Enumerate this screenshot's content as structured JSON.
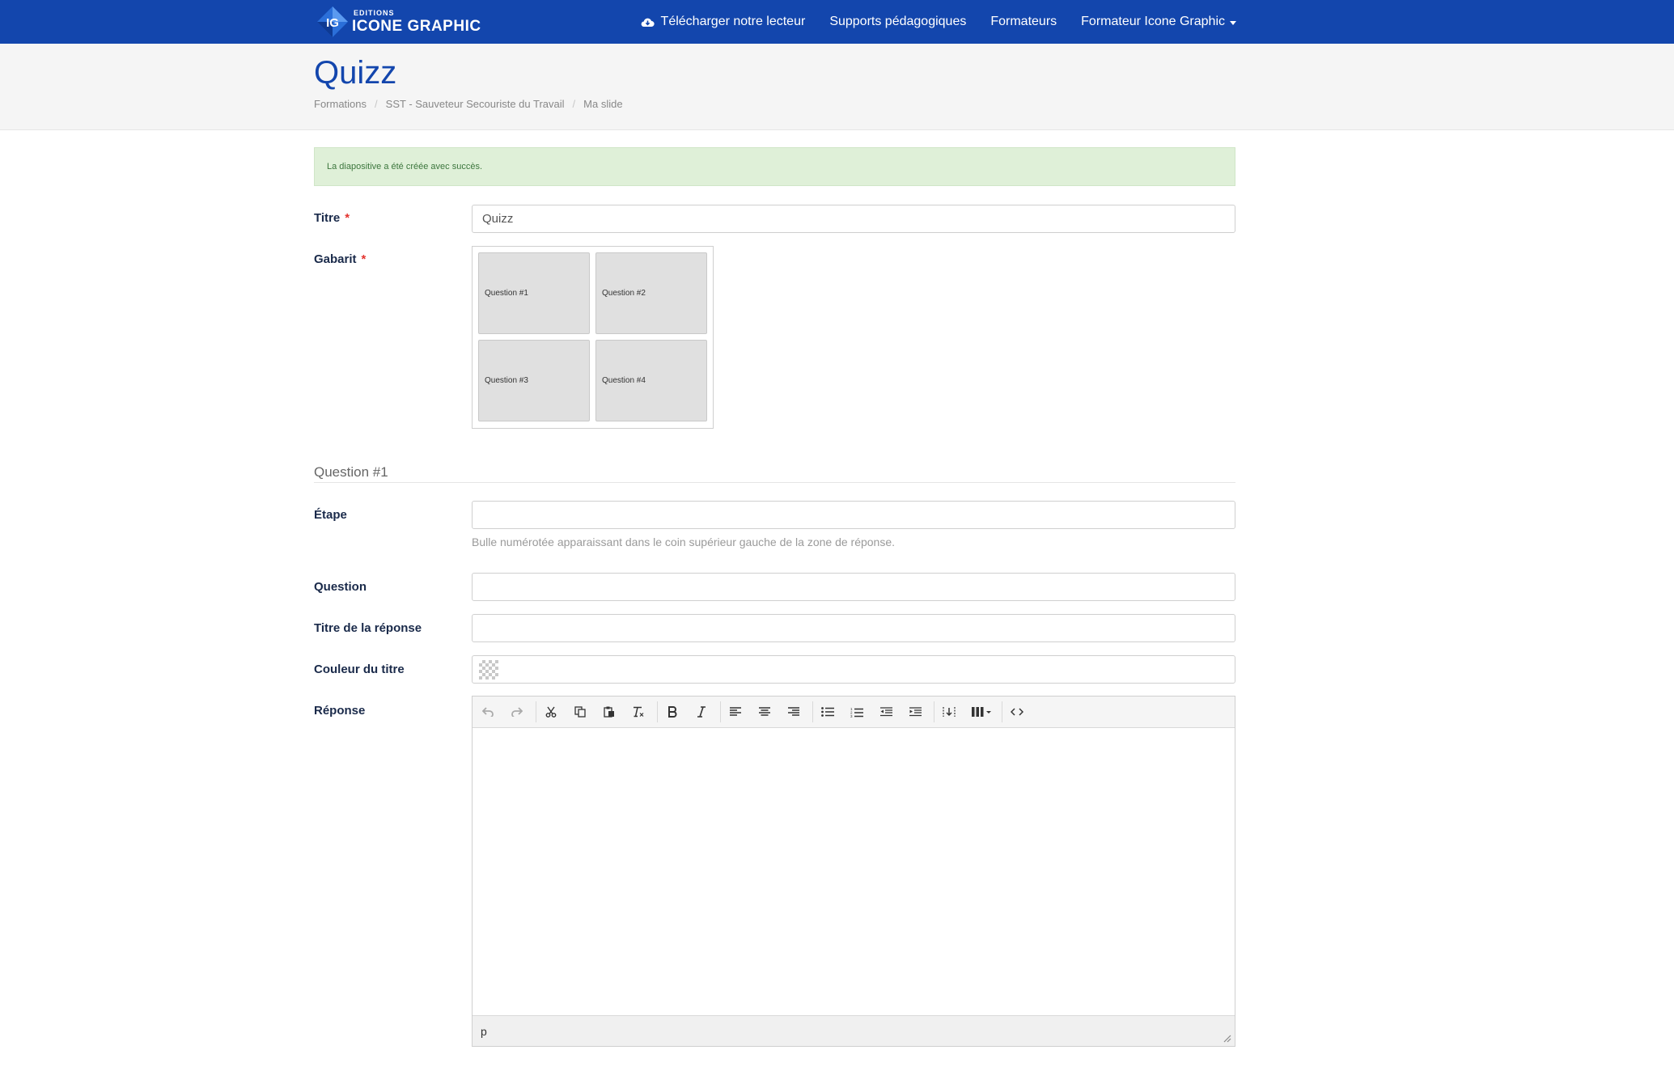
{
  "navbar": {
    "brand_small": "EDITIONS",
    "brand_big": "ICONE GRAPHIC",
    "logo_letters": "IG",
    "items": [
      {
        "label": "Télécharger notre lecteur",
        "icon": "cloud-download-icon"
      },
      {
        "label": "Supports pédagogiques"
      },
      {
        "label": "Formateurs"
      },
      {
        "label": "Formateur Icone Graphic",
        "dropdown": true
      }
    ]
  },
  "header": {
    "title": "Quizz",
    "breadcrumb": [
      "Formations",
      "SST - Sauveteur Secouriste du Travail",
      "Ma slide"
    ]
  },
  "alert": {
    "message": "La diapositive a été créée avec succès."
  },
  "form": {
    "titre_label": "Titre",
    "titre_value": "Quizz",
    "required_mark": "*",
    "gabarit_label": "Gabarit",
    "gabarit_tiles": [
      "Question #1",
      "Question #2",
      "Question #3",
      "Question #4"
    ],
    "section_title": "Question #1",
    "etape_label": "Étape",
    "etape_help": "Bulle numérotée apparaissant dans le coin supérieur gauche de la zone de réponse.",
    "question_label": "Question",
    "titre_reponse_label": "Titre de la réponse",
    "couleur_label": "Couleur du titre",
    "reponse_label": "Réponse",
    "editor_path": "p"
  },
  "colors": {
    "navbar": "#1346ad",
    "title": "#1346ad",
    "alert_bg": "#dff0d8",
    "alert_text": "#3c763d",
    "required": "#e3342f"
  }
}
